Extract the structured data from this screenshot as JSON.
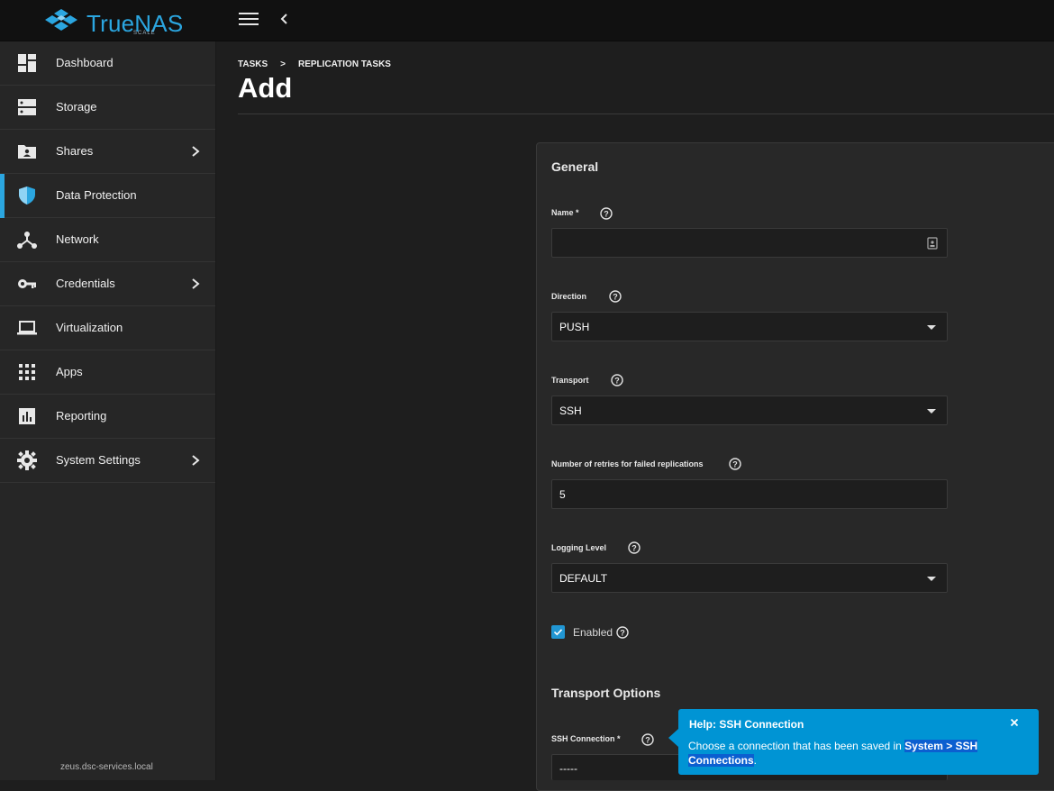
{
  "app": {
    "brand": "TrueNAS",
    "edition": "SCALE",
    "hostname": "zeus.dsc-services.local"
  },
  "sidebar": {
    "items": [
      {
        "label": "Dashboard",
        "icon": "dashboard-icon",
        "expandable": false,
        "active": false
      },
      {
        "label": "Storage",
        "icon": "storage-icon",
        "expandable": false,
        "active": false
      },
      {
        "label": "Shares",
        "icon": "shares-icon",
        "expandable": true,
        "active": false
      },
      {
        "label": "Data Protection",
        "icon": "shield-icon",
        "expandable": false,
        "active": true
      },
      {
        "label": "Network",
        "icon": "network-icon",
        "expandable": false,
        "active": false
      },
      {
        "label": "Credentials",
        "icon": "key-icon",
        "expandable": true,
        "active": false
      },
      {
        "label": "Virtualization",
        "icon": "laptop-icon",
        "expandable": false,
        "active": false
      },
      {
        "label": "Apps",
        "icon": "apps-grid-icon",
        "expandable": false,
        "active": false
      },
      {
        "label": "Reporting",
        "icon": "reporting-icon",
        "expandable": false,
        "active": false
      },
      {
        "label": "System Settings",
        "icon": "gear-icon",
        "expandable": true,
        "active": false
      }
    ]
  },
  "breadcrumb": {
    "items": [
      "TASKS",
      "REPLICATION TASKS"
    ],
    "separator": ">"
  },
  "page": {
    "title": "Add"
  },
  "form": {
    "general_title": "General",
    "name": {
      "label": "Name *",
      "value": ""
    },
    "direction": {
      "label": "Direction",
      "value": "PUSH"
    },
    "transport": {
      "label": "Transport",
      "value": "SSH"
    },
    "retries": {
      "label": "Number of retries for failed replications",
      "value": "5"
    },
    "logging_level": {
      "label": "Logging Level",
      "value": "DEFAULT"
    },
    "enabled": {
      "label": "Enabled",
      "checked": true
    },
    "transport_options_title": "Transport Options",
    "ssh_connection": {
      "label": "SSH Connection *",
      "value": "-----"
    }
  },
  "tooltip": {
    "title": "Help: SSH Connection",
    "body_prefix": "Choose a connection that has been saved in ",
    "body_highlight_1": "System > SSH",
    "body_highlight_2": "Connections",
    "body_suffix": "."
  },
  "colors": {
    "accent": "#2ba6e0",
    "tooltip": "#0094d4",
    "checkbox": "#2196d3"
  }
}
